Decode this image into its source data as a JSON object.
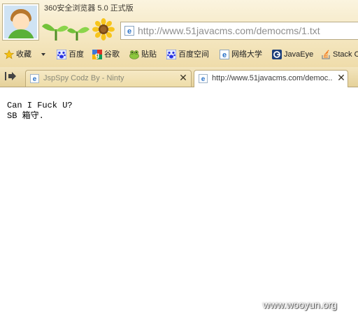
{
  "window": {
    "title": "360安全浏览器 5.0 正式版"
  },
  "address_bar": {
    "url": "http://www.51javacms.com/democms/1.txt"
  },
  "favorites": [
    {
      "label": "收藏",
      "icon": "star-icon"
    },
    {
      "label": "百度",
      "icon": "baidu-paw-icon"
    },
    {
      "label": "谷歌",
      "icon": "google-icon"
    },
    {
      "label": "贴贴",
      "icon": "frog-icon"
    },
    {
      "label": "百度空间",
      "icon": "baidu-paw-icon"
    },
    {
      "label": "网络大学",
      "icon": "ie-icon"
    },
    {
      "label": "JavaEye",
      "icon": "javaeye-icon"
    },
    {
      "label": "Stack O",
      "icon": "stackoverflow-icon"
    }
  ],
  "tabs": [
    {
      "title": "JspSpy Codz By - Ninty",
      "active": false,
      "icon": "ie-icon"
    },
    {
      "title": "http://www.51javacms.com/democ...",
      "active": true,
      "icon": "ie-icon"
    }
  ],
  "content": {
    "lines": [
      "Can I Fuck U?",
      "SB 箱守."
    ]
  },
  "watermark": "www.wooyun.org",
  "colors": {
    "chrome": "#f4e6bf",
    "accent_green": "#5ab139",
    "url_text": "#8e8e8e"
  }
}
